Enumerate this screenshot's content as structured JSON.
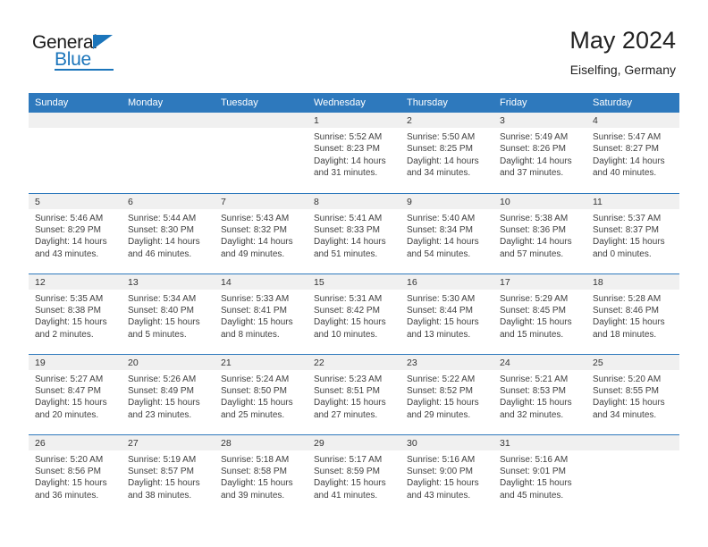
{
  "brand": {
    "name_part1": "General",
    "name_part2": "Blue",
    "accent_color": "#1b75bb"
  },
  "header": {
    "title": "May 2024",
    "subtitle": "Eiselfing, Germany"
  },
  "theme": {
    "header_blue": "#2e79bd",
    "daynum_gray": "#f0f0f0",
    "text_color": "#404040"
  },
  "weekdays": [
    "Sunday",
    "Monday",
    "Tuesday",
    "Wednesday",
    "Thursday",
    "Friday",
    "Saturday"
  ],
  "labels": {
    "sunrise": "Sunrise:",
    "sunset": "Sunset:",
    "daylight": "Daylight:"
  },
  "weeks": [
    [
      {
        "day": "",
        "empty": true
      },
      {
        "day": "",
        "empty": true
      },
      {
        "day": "",
        "empty": true
      },
      {
        "day": "1",
        "sunrise": "Sunrise: 5:52 AM",
        "sunset": "Sunset: 8:23 PM",
        "daylight1": "Daylight: 14 hours",
        "daylight2": "and 31 minutes."
      },
      {
        "day": "2",
        "sunrise": "Sunrise: 5:50 AM",
        "sunset": "Sunset: 8:25 PM",
        "daylight1": "Daylight: 14 hours",
        "daylight2": "and 34 minutes."
      },
      {
        "day": "3",
        "sunrise": "Sunrise: 5:49 AM",
        "sunset": "Sunset: 8:26 PM",
        "daylight1": "Daylight: 14 hours",
        "daylight2": "and 37 minutes."
      },
      {
        "day": "4",
        "sunrise": "Sunrise: 5:47 AM",
        "sunset": "Sunset: 8:27 PM",
        "daylight1": "Daylight: 14 hours",
        "daylight2": "and 40 minutes."
      }
    ],
    [
      {
        "day": "5",
        "sunrise": "Sunrise: 5:46 AM",
        "sunset": "Sunset: 8:29 PM",
        "daylight1": "Daylight: 14 hours",
        "daylight2": "and 43 minutes."
      },
      {
        "day": "6",
        "sunrise": "Sunrise: 5:44 AM",
        "sunset": "Sunset: 8:30 PM",
        "daylight1": "Daylight: 14 hours",
        "daylight2": "and 46 minutes."
      },
      {
        "day": "7",
        "sunrise": "Sunrise: 5:43 AM",
        "sunset": "Sunset: 8:32 PM",
        "daylight1": "Daylight: 14 hours",
        "daylight2": "and 49 minutes."
      },
      {
        "day": "8",
        "sunrise": "Sunrise: 5:41 AM",
        "sunset": "Sunset: 8:33 PM",
        "daylight1": "Daylight: 14 hours",
        "daylight2": "and 51 minutes."
      },
      {
        "day": "9",
        "sunrise": "Sunrise: 5:40 AM",
        "sunset": "Sunset: 8:34 PM",
        "daylight1": "Daylight: 14 hours",
        "daylight2": "and 54 minutes."
      },
      {
        "day": "10",
        "sunrise": "Sunrise: 5:38 AM",
        "sunset": "Sunset: 8:36 PM",
        "daylight1": "Daylight: 14 hours",
        "daylight2": "and 57 minutes."
      },
      {
        "day": "11",
        "sunrise": "Sunrise: 5:37 AM",
        "sunset": "Sunset: 8:37 PM",
        "daylight1": "Daylight: 15 hours",
        "daylight2": "and 0 minutes."
      }
    ],
    [
      {
        "day": "12",
        "sunrise": "Sunrise: 5:35 AM",
        "sunset": "Sunset: 8:38 PM",
        "daylight1": "Daylight: 15 hours",
        "daylight2": "and 2 minutes."
      },
      {
        "day": "13",
        "sunrise": "Sunrise: 5:34 AM",
        "sunset": "Sunset: 8:40 PM",
        "daylight1": "Daylight: 15 hours",
        "daylight2": "and 5 minutes."
      },
      {
        "day": "14",
        "sunrise": "Sunrise: 5:33 AM",
        "sunset": "Sunset: 8:41 PM",
        "daylight1": "Daylight: 15 hours",
        "daylight2": "and 8 minutes."
      },
      {
        "day": "15",
        "sunrise": "Sunrise: 5:31 AM",
        "sunset": "Sunset: 8:42 PM",
        "daylight1": "Daylight: 15 hours",
        "daylight2": "and 10 minutes."
      },
      {
        "day": "16",
        "sunrise": "Sunrise: 5:30 AM",
        "sunset": "Sunset: 8:44 PM",
        "daylight1": "Daylight: 15 hours",
        "daylight2": "and 13 minutes."
      },
      {
        "day": "17",
        "sunrise": "Sunrise: 5:29 AM",
        "sunset": "Sunset: 8:45 PM",
        "daylight1": "Daylight: 15 hours",
        "daylight2": "and 15 minutes."
      },
      {
        "day": "18",
        "sunrise": "Sunrise: 5:28 AM",
        "sunset": "Sunset: 8:46 PM",
        "daylight1": "Daylight: 15 hours",
        "daylight2": "and 18 minutes."
      }
    ],
    [
      {
        "day": "19",
        "sunrise": "Sunrise: 5:27 AM",
        "sunset": "Sunset: 8:47 PM",
        "daylight1": "Daylight: 15 hours",
        "daylight2": "and 20 minutes."
      },
      {
        "day": "20",
        "sunrise": "Sunrise: 5:26 AM",
        "sunset": "Sunset: 8:49 PM",
        "daylight1": "Daylight: 15 hours",
        "daylight2": "and 23 minutes."
      },
      {
        "day": "21",
        "sunrise": "Sunrise: 5:24 AM",
        "sunset": "Sunset: 8:50 PM",
        "daylight1": "Daylight: 15 hours",
        "daylight2": "and 25 minutes."
      },
      {
        "day": "22",
        "sunrise": "Sunrise: 5:23 AM",
        "sunset": "Sunset: 8:51 PM",
        "daylight1": "Daylight: 15 hours",
        "daylight2": "and 27 minutes."
      },
      {
        "day": "23",
        "sunrise": "Sunrise: 5:22 AM",
        "sunset": "Sunset: 8:52 PM",
        "daylight1": "Daylight: 15 hours",
        "daylight2": "and 29 minutes."
      },
      {
        "day": "24",
        "sunrise": "Sunrise: 5:21 AM",
        "sunset": "Sunset: 8:53 PM",
        "daylight1": "Daylight: 15 hours",
        "daylight2": "and 32 minutes."
      },
      {
        "day": "25",
        "sunrise": "Sunrise: 5:20 AM",
        "sunset": "Sunset: 8:55 PM",
        "daylight1": "Daylight: 15 hours",
        "daylight2": "and 34 minutes."
      }
    ],
    [
      {
        "day": "26",
        "sunrise": "Sunrise: 5:20 AM",
        "sunset": "Sunset: 8:56 PM",
        "daylight1": "Daylight: 15 hours",
        "daylight2": "and 36 minutes."
      },
      {
        "day": "27",
        "sunrise": "Sunrise: 5:19 AM",
        "sunset": "Sunset: 8:57 PM",
        "daylight1": "Daylight: 15 hours",
        "daylight2": "and 38 minutes."
      },
      {
        "day": "28",
        "sunrise": "Sunrise: 5:18 AM",
        "sunset": "Sunset: 8:58 PM",
        "daylight1": "Daylight: 15 hours",
        "daylight2": "and 39 minutes."
      },
      {
        "day": "29",
        "sunrise": "Sunrise: 5:17 AM",
        "sunset": "Sunset: 8:59 PM",
        "daylight1": "Daylight: 15 hours",
        "daylight2": "and 41 minutes."
      },
      {
        "day": "30",
        "sunrise": "Sunrise: 5:16 AM",
        "sunset": "Sunset: 9:00 PM",
        "daylight1": "Daylight: 15 hours",
        "daylight2": "and 43 minutes."
      },
      {
        "day": "31",
        "sunrise": "Sunrise: 5:16 AM",
        "sunset": "Sunset: 9:01 PM",
        "daylight1": "Daylight: 15 hours",
        "daylight2": "and 45 minutes."
      },
      {
        "day": "",
        "empty": true
      }
    ]
  ]
}
